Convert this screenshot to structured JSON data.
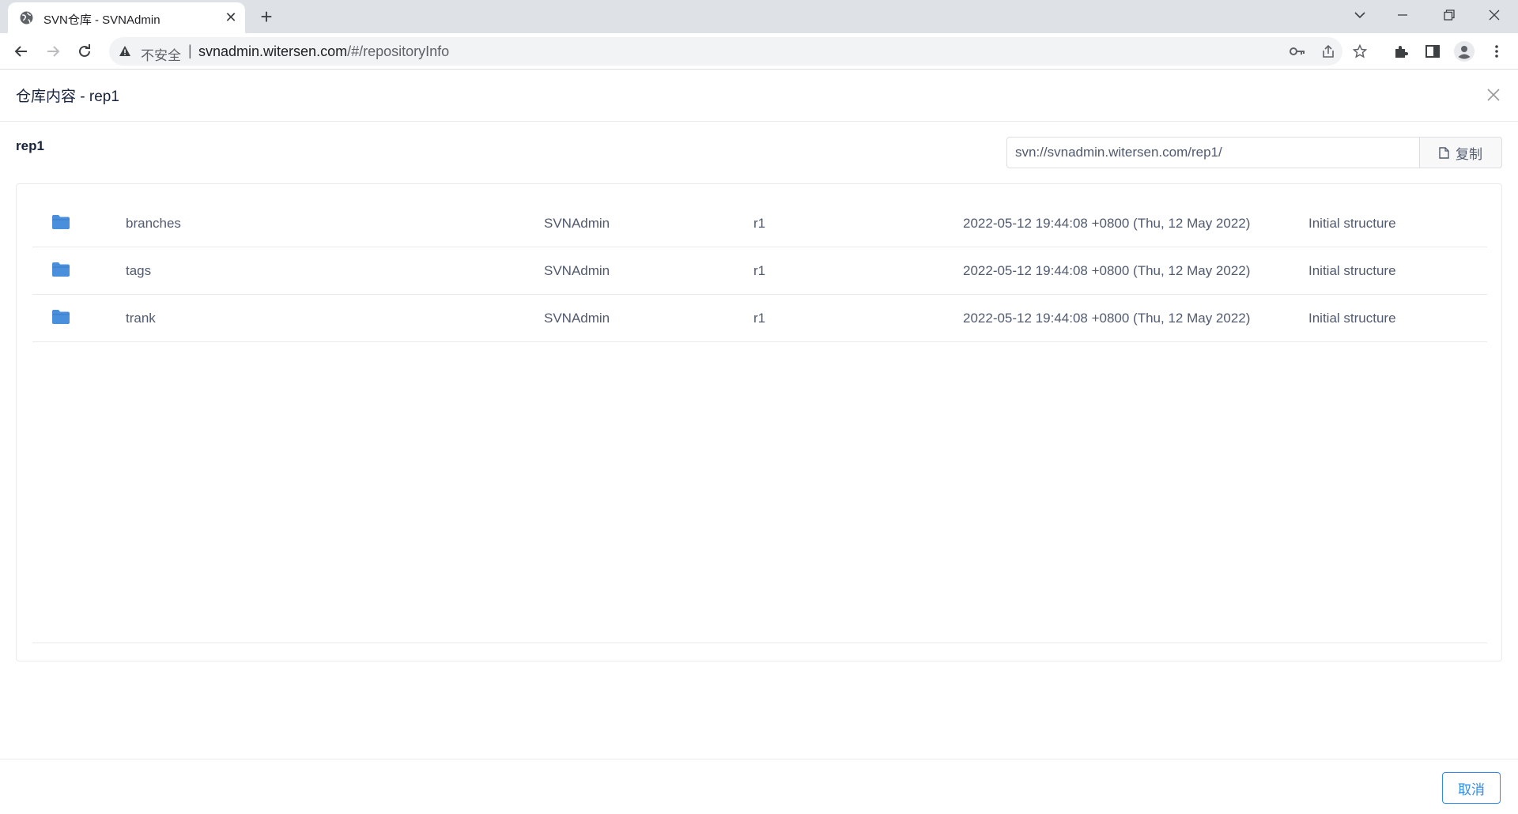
{
  "browser": {
    "tab_title": "SVN仓库 - SVNAdmin",
    "tab_close_glyph": "✕",
    "new_tab_glyph": "+",
    "security_label": "不安全",
    "separator": "|",
    "url_host": "svnadmin.witersen.com",
    "url_path": "/#/repositoryInfo"
  },
  "modal": {
    "title": "仓库内容 - rep1",
    "repo_name": "rep1",
    "checkout_url": "svn://svnadmin.witersen.com/rep1/",
    "copy_label": "复制",
    "cancel_label": "取消"
  },
  "entries": [
    {
      "name": "branches",
      "author": "SVNAdmin",
      "revision": "r1",
      "date": "2022-05-12 19:44:08 +0800 (Thu, 12 May 2022)",
      "message": "Initial structure",
      "icon": "folder-icon"
    },
    {
      "name": "tags",
      "author": "SVNAdmin",
      "revision": "r1",
      "date": "2022-05-12 19:44:08 +0800 (Thu, 12 May 2022)",
      "message": "Initial structure",
      "icon": "folder-icon"
    },
    {
      "name": "trank",
      "author": "SVNAdmin",
      "revision": "r1",
      "date": "2022-05-12 19:44:08 +0800 (Thu, 12 May 2022)",
      "message": "Initial structure",
      "icon": "folder-icon"
    }
  ],
  "colors": {
    "accent": "#2d8cf0",
    "folder": "#4a8fdc",
    "text": "#515a6e",
    "title": "#17233d",
    "border": "#e8eaec"
  }
}
